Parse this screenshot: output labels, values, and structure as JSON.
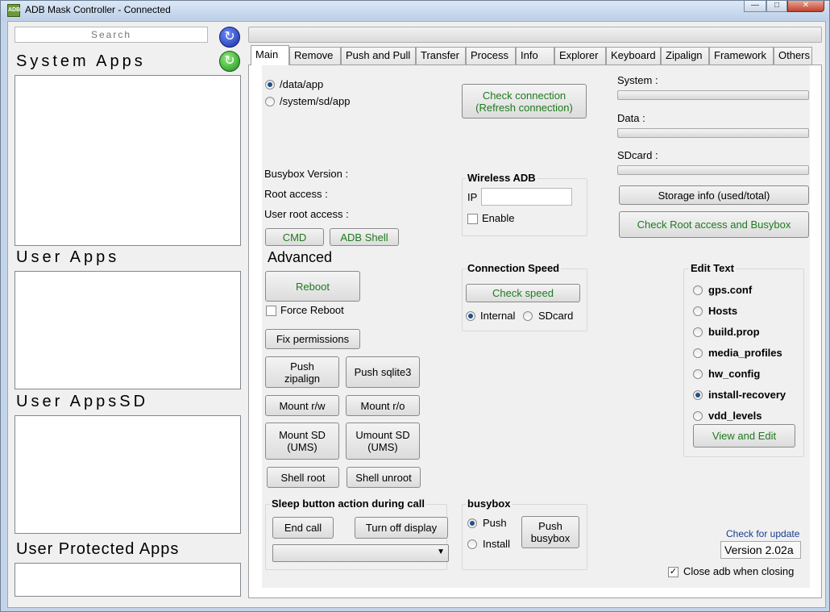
{
  "window": {
    "title": "ADB Mask Controller - Connected",
    "app_icon_text": "ADB"
  },
  "left": {
    "search_placeholder": "Search",
    "system_apps_label": "System Apps",
    "user_apps_label": "User Apps",
    "user_apps_sd_label": "User AppsSD",
    "user_protected_apps_label": "User Protected Apps"
  },
  "tabs": [
    "Main",
    "Remove",
    "Push and Pull",
    "Transfer",
    "Process",
    "Info",
    "Explorer",
    "Keyboard",
    "Zipalign",
    "Framework",
    "Others"
  ],
  "main": {
    "install_location": {
      "options": [
        "/data/app",
        "/system/sd/app"
      ],
      "selected": "/data/app"
    },
    "check_connection_label": "Check connection\n(Refresh connection)",
    "storage": {
      "system_label": "System :",
      "data_label": "Data :",
      "sdcard_label": "SDcard :"
    },
    "storage_info_label": "Storage info (used/total)",
    "check_root_label": "Check Root access and Busybox",
    "busybox_version_label": "Busybox Version :",
    "root_access_label": "Root access :",
    "user_root_access_label": "User root access :",
    "wireless": {
      "title": "Wireless ADB",
      "ip_label": "IP",
      "ip_value": "",
      "enable_label": "Enable"
    },
    "cmd_label": "CMD",
    "adb_shell_label": "ADB Shell",
    "advanced_label": "Advanced",
    "reboot_label": "Reboot",
    "force_reboot_label": "Force Reboot",
    "fix_permissions_label": "Fix permissions",
    "push_zipalign_label": "Push\nzipalign",
    "push_sqlite3_label": "Push sqlite3",
    "mount_rw_label": "Mount r/w",
    "mount_ro_label": "Mount r/o",
    "mount_sd_label": "Mount SD\n(UMS)",
    "umount_sd_label": "Umount SD\n(UMS)",
    "shell_root_label": "Shell root",
    "shell_unroot_label": "Shell unroot",
    "speed": {
      "title": "Connection Speed",
      "check_label": "Check speed",
      "options": [
        "Internal",
        "SDcard"
      ],
      "selected": "Internal"
    },
    "edit_text": {
      "title": "Edit Text",
      "options": [
        "gps.conf",
        "Hosts",
        "build.prop",
        "media_profiles",
        "hw_config",
        "install-recovery",
        "vdd_levels"
      ],
      "selected": "install-recovery",
      "view_edit_label": "View and Edit"
    },
    "sleep": {
      "title": "Sleep button action during call",
      "end_call_label": "End call",
      "turn_off_label": "Turn off display",
      "dropdown_value": ""
    },
    "busybox": {
      "title": "busybox",
      "options": [
        "Push",
        "Install"
      ],
      "selected": "Push",
      "push_button_label": "Push\nbusybox"
    },
    "check_update_label": "Check for update",
    "version_label": "Version 2.02a",
    "close_adb_label": "Close adb when closing",
    "close_adb_checked": true
  },
  "colors": {
    "accent_green": "#1e7a1e",
    "link_blue": "#1a3c8c",
    "radio_blue": "#1f4f8f"
  }
}
